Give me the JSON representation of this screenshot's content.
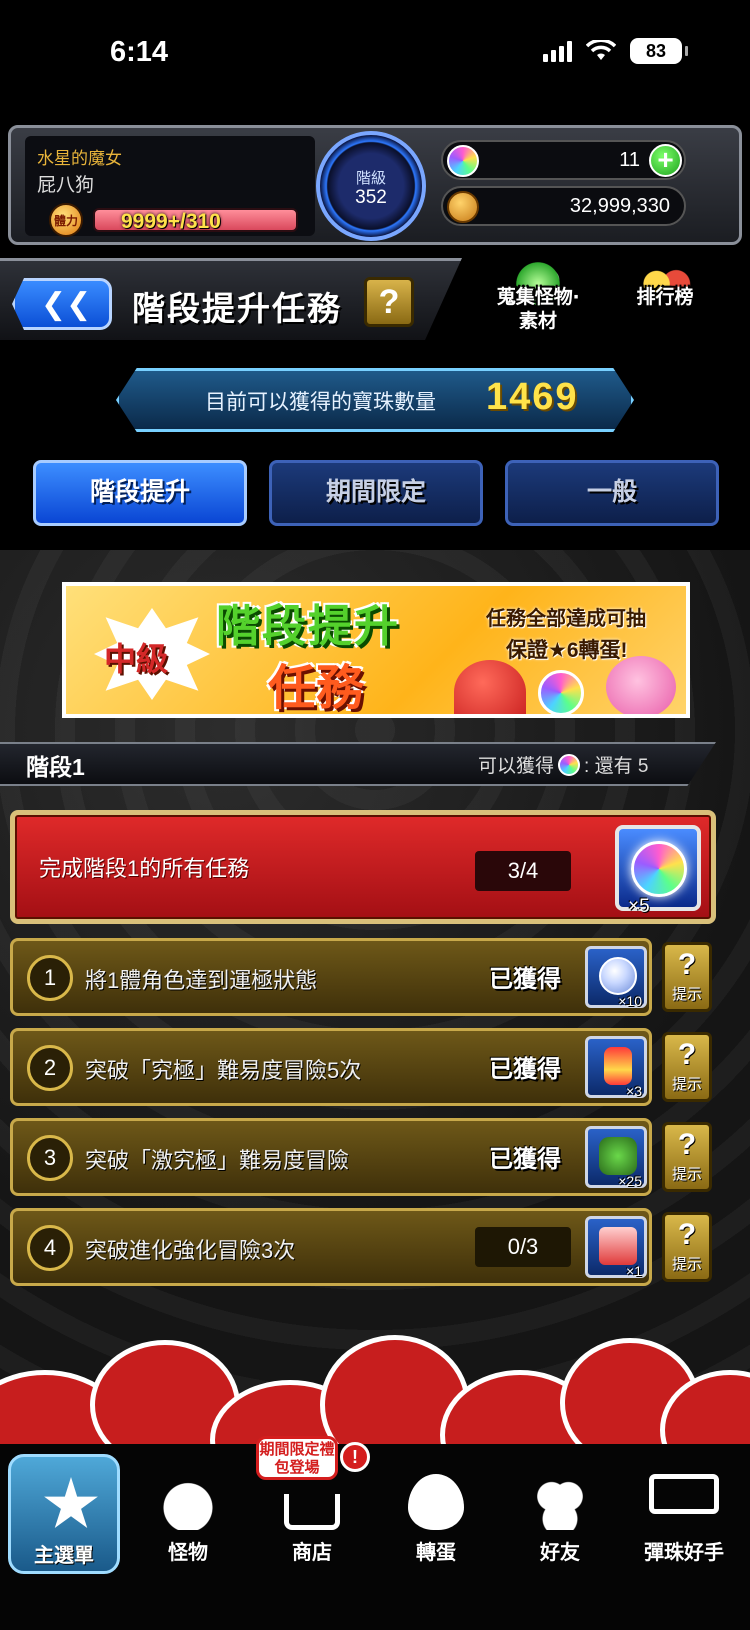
{
  "status_bar": {
    "time": "6:14",
    "battery": "83"
  },
  "player": {
    "title": "水星的魔女",
    "name": "屁八狗",
    "stamina_icon_label": "體力",
    "stamina": "9999+/310",
    "rank_label": "階級",
    "rank": "352",
    "orbs": "11",
    "gold": "32,999,330"
  },
  "header": {
    "title": "階段提升任務",
    "help_label": "?",
    "shortcut_collect": "蒐集怪物‧素材",
    "shortcut_ranking": "排行榜"
  },
  "orb_summary": {
    "label": "目前可以獲得的寶珠數量",
    "value": "1469"
  },
  "tabs": [
    {
      "label": "階段提升",
      "active": true
    },
    {
      "label": "期間限定",
      "active": false
    },
    {
      "label": "一般",
      "active": false
    }
  ],
  "banner": {
    "level": "中級",
    "title": "階段提升",
    "subtitle": "任務",
    "note_line1": "任務全部達成可抽",
    "note_line2": "保證★6轉蛋!"
  },
  "stage": {
    "label": "階段1",
    "reward_prefix": "可以獲得",
    "reward_suffix": ": 還有 5"
  },
  "master_mission": {
    "label": "完成階段1的所有任務",
    "progress": "3/4",
    "reward_qty": "×5"
  },
  "missions": [
    {
      "num": "1",
      "text": "將1體角色達到運極狀態",
      "status": "已獲得",
      "reward": "orb-shard",
      "qty": "×10"
    },
    {
      "num": "2",
      "text": "突破「究極」難易度冒險5次",
      "status": "已獲得",
      "reward": "energy-can",
      "qty": "×3"
    },
    {
      "num": "3",
      "text": "突破「激究極」難易度冒險",
      "status": "已獲得",
      "reward": "monster-card",
      "qty": "×25"
    },
    {
      "num": "4",
      "text": "突破進化強化冒險3次",
      "progress": "0/3",
      "reward": "scroll",
      "qty": "×1"
    }
  ],
  "hint_label": "提示",
  "bottom_nav": {
    "home": "主選單",
    "monster": "怪物",
    "shop": "商店",
    "gacha": "轉蛋",
    "friends": "好友",
    "helper": "彈珠好手",
    "shop_badge": "期間限定禮包登場",
    "alert": "!"
  },
  "colors": {
    "accent_blue": "#0a46d4",
    "master_red": "#e02a2a",
    "mission_gold": "#6e5818",
    "orb_value_yellow": "#ffe34a"
  }
}
